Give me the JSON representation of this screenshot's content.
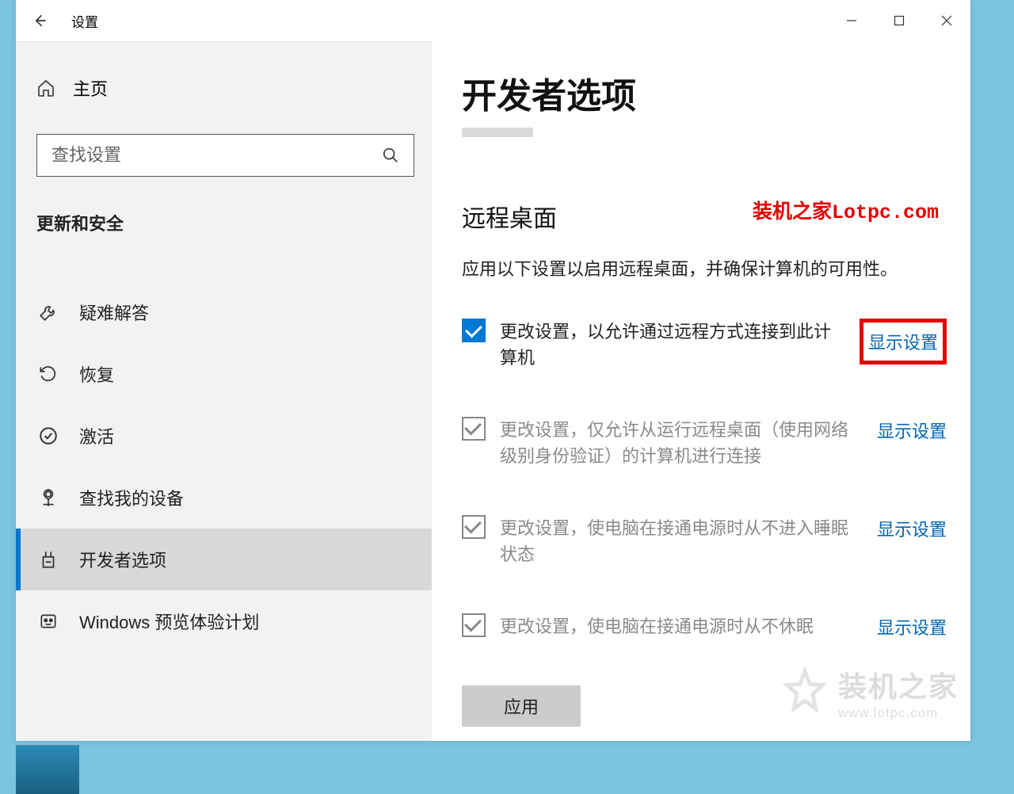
{
  "titlebar": {
    "title": "设置"
  },
  "sidebar": {
    "home": "主页",
    "search_placeholder": "查找设置",
    "category": "更新和安全",
    "items": [
      {
        "label": "疑难解答"
      },
      {
        "label": "恢复"
      },
      {
        "label": "激活"
      },
      {
        "label": "查找我的设备"
      },
      {
        "label": "开发者选项"
      },
      {
        "label": "Windows 预览体验计划"
      }
    ]
  },
  "content": {
    "page_title": "开发者选项",
    "watermark": "装机之家Lotpc.com",
    "section_title": "远程桌面",
    "section_desc": "应用以下设置以启用远程桌面，并确保计算机的可用性。",
    "settings": [
      {
        "label": "更改设置，以允许通过远程方式连接到此计算机",
        "link": "显示设置",
        "checked": true,
        "disabled": false,
        "highlight": true
      },
      {
        "label": "更改设置，仅允许从运行远程桌面（使用网络级别身份验证）的计算机进行连接",
        "link": "显示设置",
        "checked": true,
        "disabled": true,
        "highlight": false
      },
      {
        "label": "更改设置，使电脑在接通电源时从不进入睡眠状态",
        "link": "显示设置",
        "checked": true,
        "disabled": true,
        "highlight": false
      },
      {
        "label": "更改设置，使电脑在接通电源时从不休眠",
        "link": "显示设置",
        "checked": true,
        "disabled": true,
        "highlight": false
      }
    ],
    "apply_button": "应用"
  },
  "logo": {
    "cn": "装机之家",
    "en": "www.lotpc.com"
  }
}
